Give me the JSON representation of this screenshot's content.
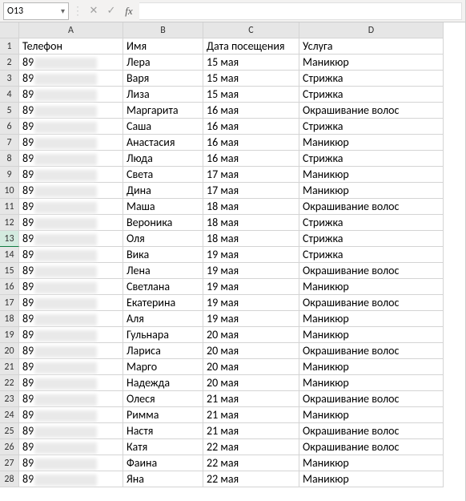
{
  "formula_bar": {
    "name_box": "O13",
    "cancel_icon": "✕",
    "confirm_icon": "✓",
    "fx_label": "fx",
    "input_value": ""
  },
  "columns": [
    "A",
    "B",
    "C",
    "D"
  ],
  "headers": {
    "A": "Телефон",
    "B": "Имя",
    "C": "Дата посещения",
    "D": "Услуга"
  },
  "active_row": 13,
  "phone_prefix": "89",
  "rows": [
    {
      "n": 1
    },
    {
      "n": 2,
      "name": "Лера",
      "date": "15 мая",
      "service": "Маникюр"
    },
    {
      "n": 3,
      "name": "Варя",
      "date": "15 мая",
      "service": "Стрижка"
    },
    {
      "n": 4,
      "name": "Лиза",
      "date": "15 мая",
      "service": "Стрижка"
    },
    {
      "n": 5,
      "name": "Маргарита",
      "date": "16 мая",
      "service": "Окрашивание волос"
    },
    {
      "n": 6,
      "name": "Саша",
      "date": "16 мая",
      "service": "Стрижка"
    },
    {
      "n": 7,
      "name": "Анастасия",
      "date": "16 мая",
      "service": "Маникюр"
    },
    {
      "n": 8,
      "name": "Люда",
      "date": "16 мая",
      "service": "Стрижка"
    },
    {
      "n": 9,
      "name": "Света",
      "date": "17 мая",
      "service": "Маникюр"
    },
    {
      "n": 10,
      "name": "Дина",
      "date": "17 мая",
      "service": "Маникюр"
    },
    {
      "n": 11,
      "name": "Маша",
      "date": "18 мая",
      "service": "Окрашивание волос"
    },
    {
      "n": 12,
      "name": "Вероника",
      "date": "18 мая",
      "service": "Стрижка"
    },
    {
      "n": 13,
      "name": "Оля",
      "date": "18 мая",
      "service": "Стрижка"
    },
    {
      "n": 14,
      "name": "Вика",
      "date": "19 мая",
      "service": "Стрижка"
    },
    {
      "n": 15,
      "name": "Лена",
      "date": "19 мая",
      "service": "Окрашивание волос"
    },
    {
      "n": 16,
      "name": "Светлана",
      "date": "19 мая",
      "service": "Маникюр"
    },
    {
      "n": 17,
      "name": "Екатерина",
      "date": "19 мая",
      "service": "Окрашивание волос"
    },
    {
      "n": 18,
      "name": "Аля",
      "date": "19 мая",
      "service": "Маникюр"
    },
    {
      "n": 19,
      "name": "Гульнара",
      "date": "20 мая",
      "service": "Маникюр"
    },
    {
      "n": 20,
      "name": "Лариса",
      "date": "20 мая",
      "service": "Окрашивание волос"
    },
    {
      "n": 21,
      "name": "Марго",
      "date": "20 мая",
      "service": "Маникюр"
    },
    {
      "n": 22,
      "name": "Надежда",
      "date": "20 мая",
      "service": "Маникюр"
    },
    {
      "n": 23,
      "name": "Олеся",
      "date": "21 мая",
      "service": "Окрашивание волос"
    },
    {
      "n": 24,
      "name": "Римма",
      "date": "21 мая",
      "service": "Маникюр"
    },
    {
      "n": 25,
      "name": "Настя",
      "date": "21 мая",
      "service": "Окрашивание волос"
    },
    {
      "n": 26,
      "name": "Катя",
      "date": "22 мая",
      "service": "Окрашивание волос"
    },
    {
      "n": 27,
      "name": "Фаина",
      "date": "22 мая",
      "service": "Маникюр"
    },
    {
      "n": 28,
      "name": "Яна",
      "date": "22 мая",
      "service": "Маникюр"
    }
  ]
}
